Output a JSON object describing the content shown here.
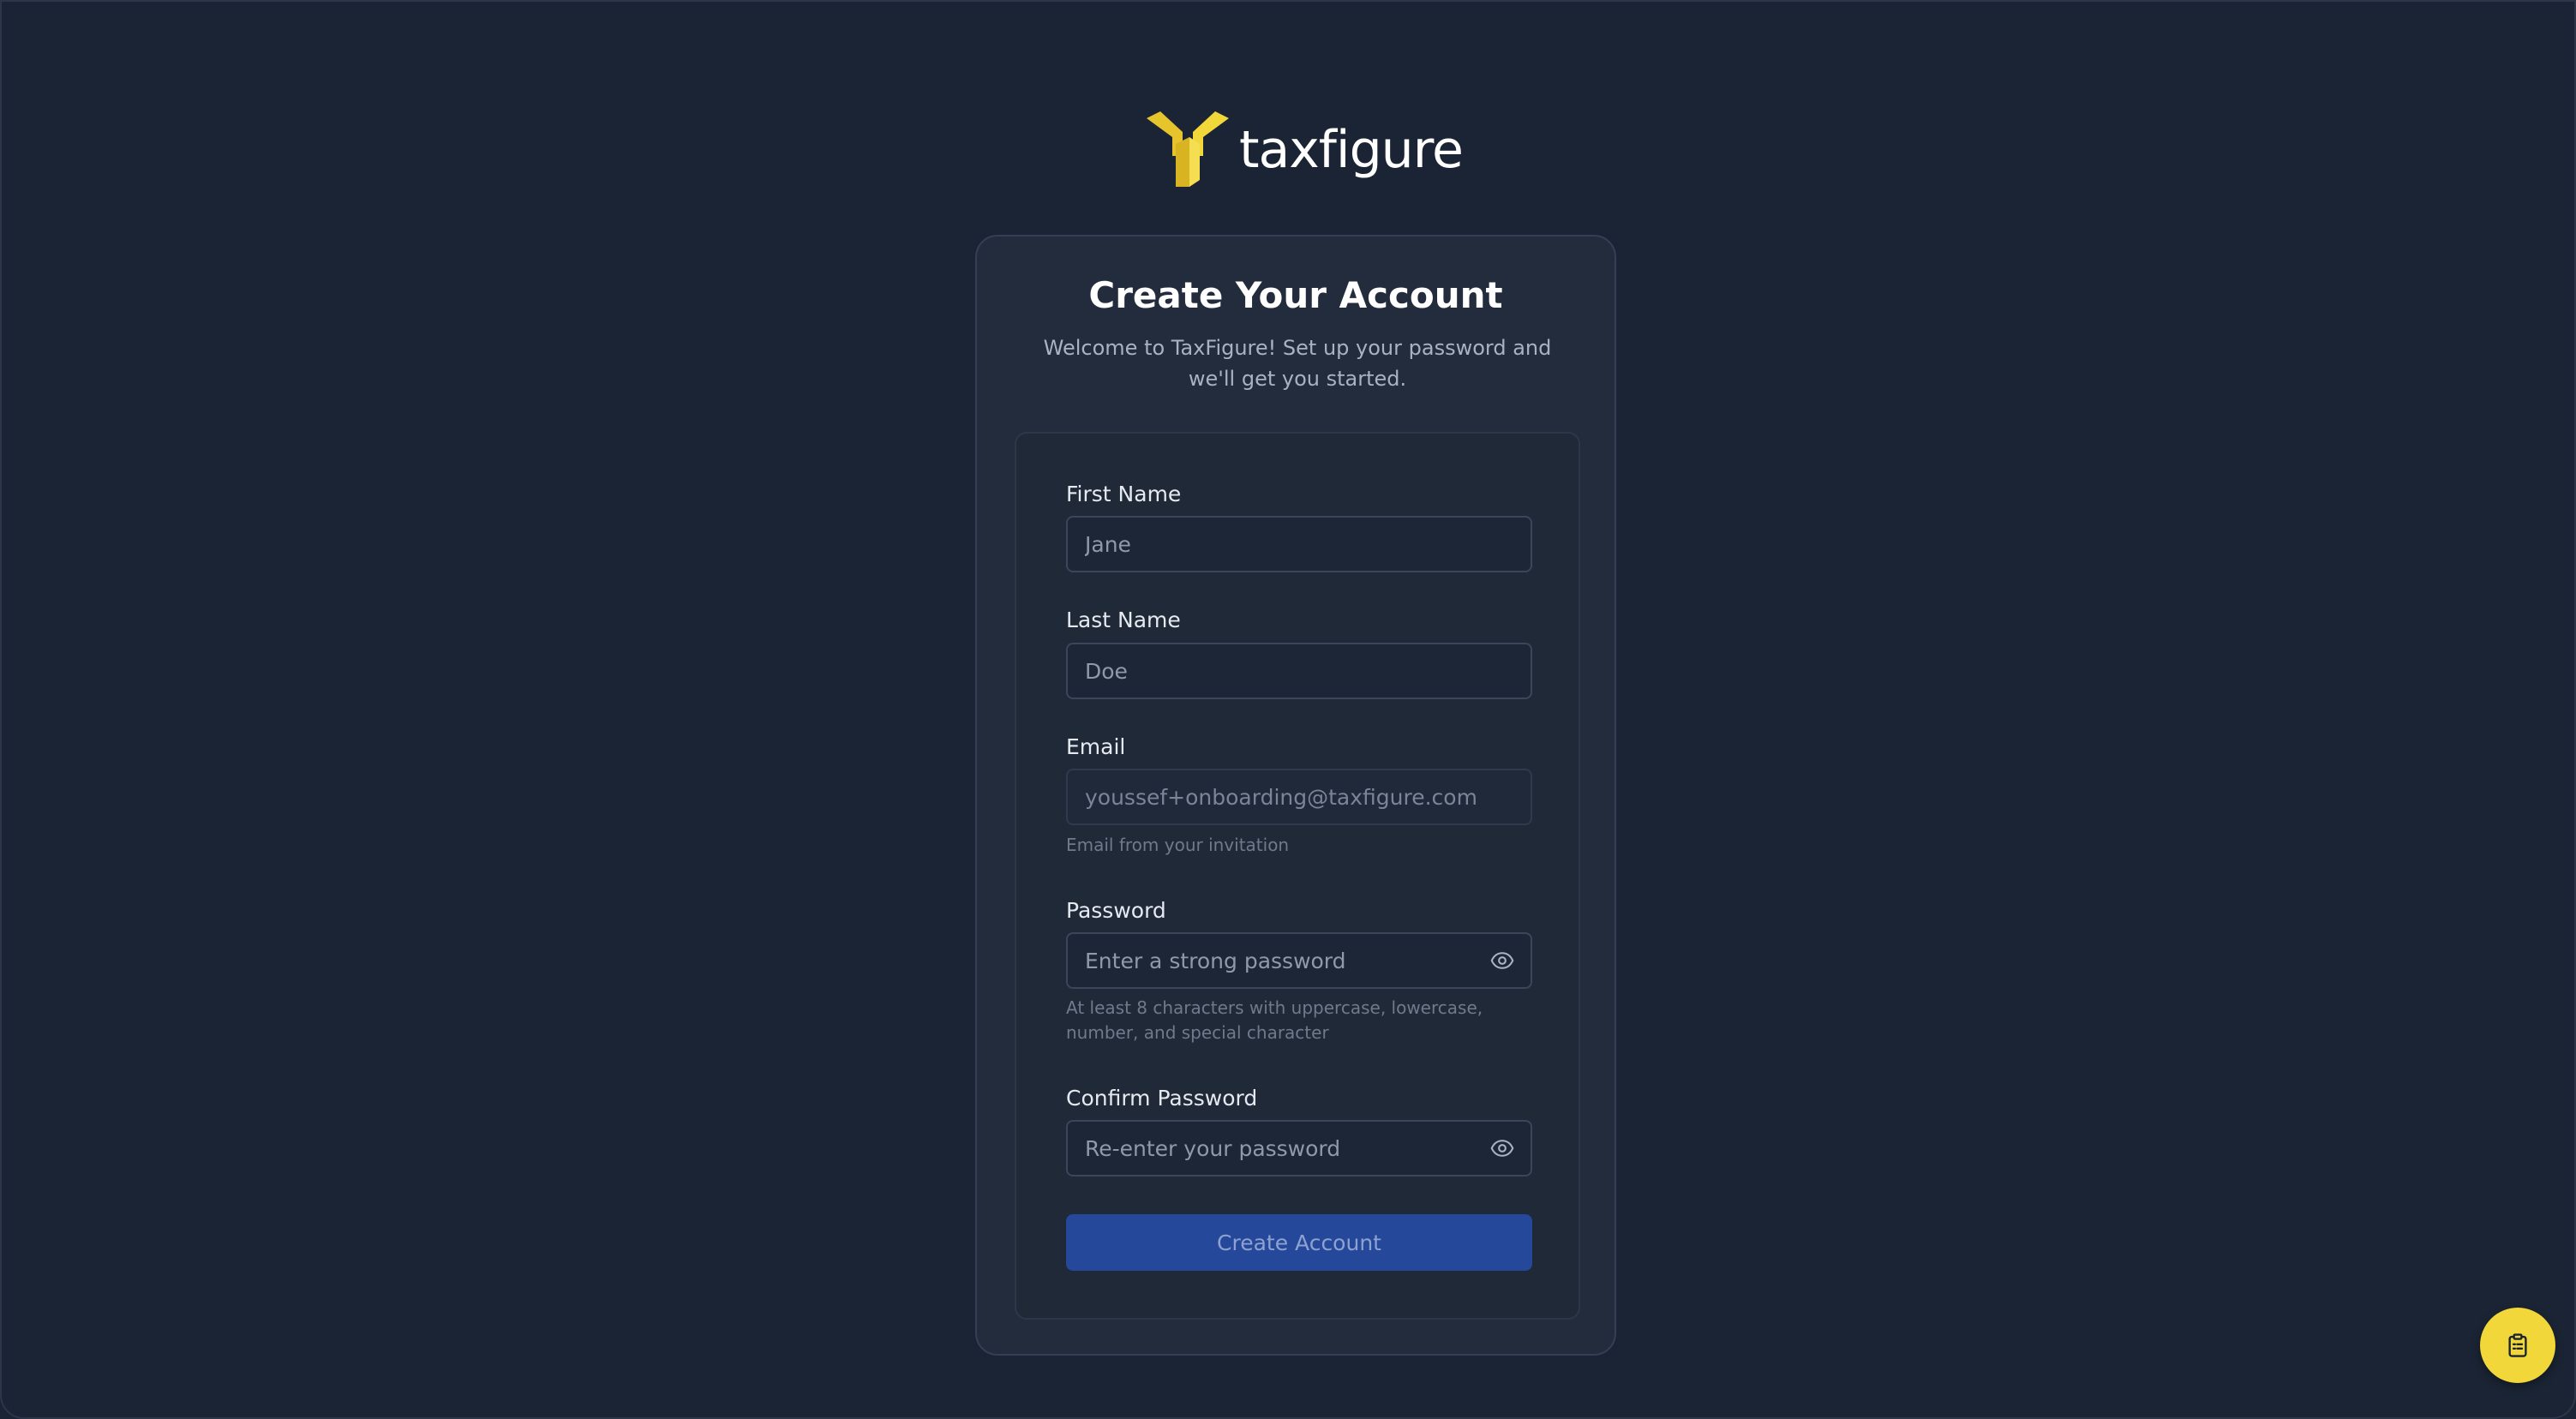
{
  "brand": {
    "name": "taxfigure",
    "logo_color": "#f2d73a"
  },
  "card": {
    "title": "Create Your Account",
    "subtitle": "Welcome to TaxFigure! Set up your password and we'll get you started."
  },
  "form": {
    "first_name": {
      "label": "First Name",
      "placeholder": "Jane"
    },
    "last_name": {
      "label": "Last Name",
      "placeholder": "Doe"
    },
    "email": {
      "label": "Email",
      "placeholder": "youssef+onboarding@taxfigure.com",
      "hint": "Email from your invitation"
    },
    "password": {
      "label": "Password",
      "placeholder": "Enter a strong password",
      "hint": "At least 8 characters with uppercase, lowercase, number, and special character",
      "toggle_icon": "eye-icon"
    },
    "confirm_password": {
      "label": "Confirm Password",
      "placeholder": "Re-enter your password",
      "toggle_icon": "eye-icon"
    },
    "submit_label": "Create Account"
  },
  "fab": {
    "icon": "clipboard-icon"
  },
  "colors": {
    "background": "#1b2434",
    "card": "#222c3c",
    "primary_button": "#25489a",
    "accent": "#f2d73a"
  }
}
